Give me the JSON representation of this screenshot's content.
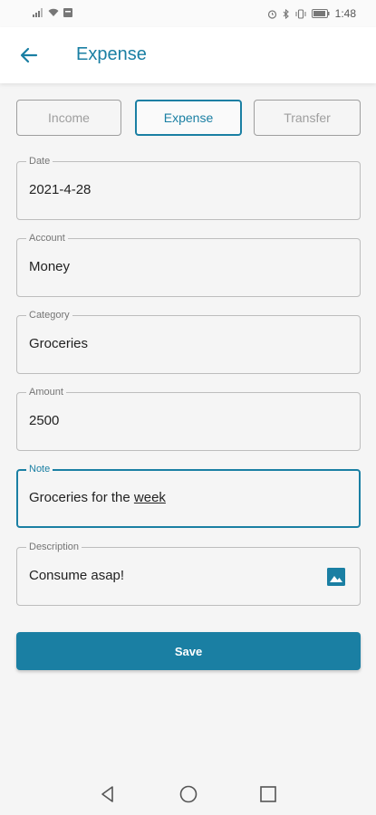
{
  "status_bar": {
    "time": "1:48"
  },
  "app_bar": {
    "title": "Expense"
  },
  "tabs": [
    {
      "label": "Income",
      "active": false
    },
    {
      "label": "Expense",
      "active": true
    },
    {
      "label": "Transfer",
      "active": false
    }
  ],
  "form": {
    "date": {
      "label": "Date",
      "value": "2021-4-28"
    },
    "account": {
      "label": "Account",
      "value": "Money"
    },
    "category": {
      "label": "Category",
      "value": "Groceries"
    },
    "amount": {
      "label": "Amount",
      "value": "2500"
    },
    "note": {
      "label": "Note",
      "value_prefix": "Groceries for the ",
      "value_underlined": "week"
    },
    "description": {
      "label": "Description",
      "value": "Consume asap!"
    }
  },
  "save_label": "Save",
  "colors": {
    "accent": "#1a7fa3",
    "background": "#f5f5f5",
    "border": "#bdbdbd"
  },
  "icons": [
    "signal-icon",
    "wifi-icon",
    "alarm-icon",
    "bluetooth-icon",
    "vibrate-icon",
    "battery-icon",
    "back-arrow-icon",
    "image-icon",
    "nav-back-icon",
    "nav-home-icon",
    "nav-recents-icon"
  ]
}
